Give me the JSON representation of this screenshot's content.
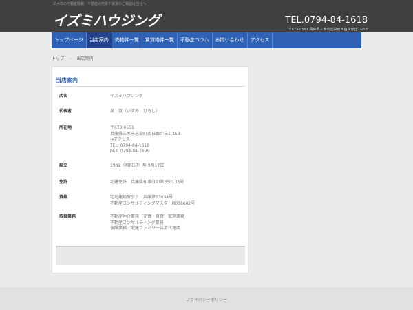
{
  "header": {
    "tagline": "三木市の不動産情報　不動産の売買や賃貸のご相談は当社へ",
    "logo": "イズミハウジング",
    "tel": "TEL.0794-84-1618",
    "address": "〒673-0551 兵庫県三木市志染町西自由が丘1-253"
  },
  "nav": {
    "items": [
      {
        "label": "トップページ"
      },
      {
        "label": "当店案内"
      },
      {
        "label": "売物件一覧"
      },
      {
        "label": "賃貸物件一覧"
      },
      {
        "label": "不動産コラム"
      },
      {
        "label": "お問い合わせ"
      },
      {
        "label": "アクセス"
      }
    ]
  },
  "breadcrumb": {
    "home": "トップ",
    "separator": "›",
    "current": "当店案内"
  },
  "page": {
    "title": "当店案内",
    "rows": [
      {
        "label": "店名",
        "lines": [
          "イズミハウジング"
        ]
      },
      {
        "label": "代表者",
        "lines": [
          "泉　寛（いずみ　ひろし）"
        ]
      },
      {
        "label": "所在地",
        "lines": [
          "〒673-0551",
          "兵庫県三木市志染町西自由が丘1-253",
          "→アクセス",
          "TEL. 0794-84-1618",
          "FAX. 0794-84-1699"
        ]
      },
      {
        "label": "設立",
        "lines": [
          "1982（昭和57）年 9月17日"
        ]
      },
      {
        "label": "免許",
        "lines": [
          "宅建免許　兵庫県知事(11)第350133号"
        ]
      },
      {
        "label": "資格",
        "lines": [
          "宅地建物取引士　兵庫第13034号",
          "不動産コンサルティングマスター(8)18682号"
        ]
      },
      {
        "label": "取扱業務",
        "lines": [
          "不動産仲介業務（売買・賃貸）管理業務",
          "不動産コンサルティング業務",
          "保険業務／宅建ファミリー共済代理店"
        ]
      }
    ]
  },
  "footer": {
    "privacy": "プライバシーポリシー"
  }
}
